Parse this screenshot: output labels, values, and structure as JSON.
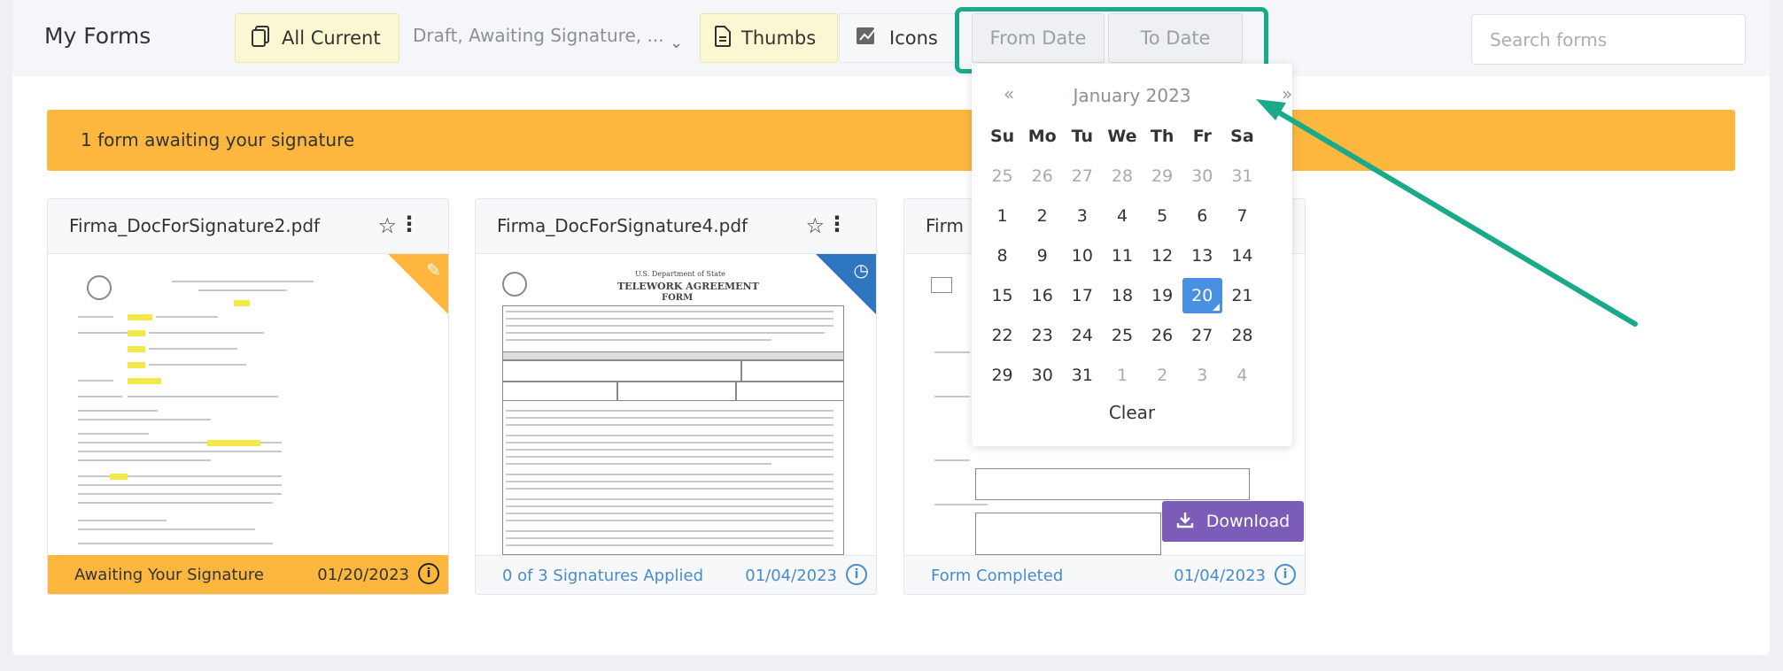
{
  "header": {
    "title": "My Forms",
    "all_current_label": "All Current",
    "status_filter": "Draft, Awaiting Signature, ...",
    "thumbs_label": "Thumbs",
    "icons_label": "Icons",
    "from_date_label": "From Date",
    "to_date_label": "To Date",
    "search_placeholder": "Search forms"
  },
  "banner": {
    "text": "1 form awaiting your signature"
  },
  "cards": [
    {
      "title": "Firma_DocForSignature2.pdf",
      "status": "Awaiting Your Signature",
      "date": "01/20/2023",
      "corner_color": "#fdb73f"
    },
    {
      "title": "Firma_DocForSignature4.pdf",
      "status": "0 of 3 Signatures Applied",
      "date": "01/04/2023",
      "corner_color": "#2e76c0"
    },
    {
      "title": "Firm",
      "status": "Form Completed",
      "date": "01/04/2023",
      "download_label": "Download"
    }
  ],
  "calendar": {
    "prev": "«",
    "next": "»",
    "month": "January 2023",
    "weekdays": [
      "Su",
      "Mo",
      "Tu",
      "We",
      "Th",
      "Fr",
      "Sa"
    ],
    "weeks": [
      [
        "25",
        "26",
        "27",
        "28",
        "29",
        "30",
        "31"
      ],
      [
        "1",
        "2",
        "3",
        "4",
        "5",
        "6",
        "7"
      ],
      [
        "8",
        "9",
        "10",
        "11",
        "12",
        "13",
        "14"
      ],
      [
        "15",
        "16",
        "17",
        "18",
        "19",
        "20",
        "21"
      ],
      [
        "22",
        "23",
        "24",
        "25",
        "26",
        "27",
        "28"
      ],
      [
        "29",
        "30",
        "31",
        "1",
        "2",
        "3",
        "4"
      ]
    ],
    "selected": "20",
    "clear_label": "Clear"
  },
  "preview_texts": {
    "doc2_title": "TELEWORK AGREEMENT",
    "doc2_subtitle": "FORM",
    "doc2_dept": "U.S. Department of State"
  },
  "colors": {
    "accent_yellow": "#fdb73f",
    "highlight_green": "#1aaa8a",
    "download_purple": "#7b5cb8",
    "calendar_selected": "#4a90e2"
  }
}
